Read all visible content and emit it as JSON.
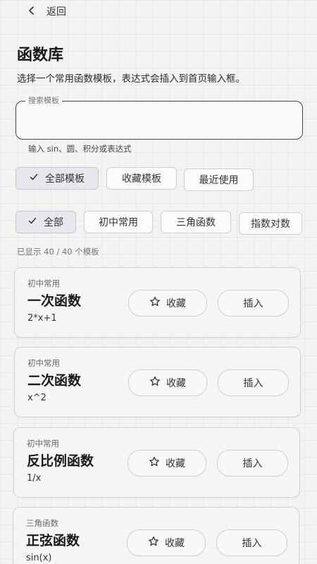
{
  "header": {
    "back_label": "返回"
  },
  "page": {
    "title": "函数库",
    "description": "选择一个常用函数模板，表达式会插入到首页输入框。"
  },
  "search": {
    "legend": "搜索模板",
    "value": "",
    "placeholder": "",
    "hint": "输入 sin、圆、积分或表达式"
  },
  "scope_tabs": [
    {
      "label": "全部模板",
      "selected": true
    },
    {
      "label": "收藏模板",
      "selected": false
    },
    {
      "label": "最近使用",
      "selected": false
    }
  ],
  "category_tabs": [
    {
      "label": "全部",
      "selected": true
    },
    {
      "label": "初中常用",
      "selected": false
    },
    {
      "label": "三角函数",
      "selected": false
    },
    {
      "label": "指数对数",
      "selected": false
    }
  ],
  "count_text": "已显示 40 / 40 个模板",
  "templates": [
    {
      "category": "初中常用",
      "name": "一次函数",
      "expr": "2*x+1",
      "fav_label": "收藏",
      "insert_label": "插入"
    },
    {
      "category": "初中常用",
      "name": "二次函数",
      "expr": "x^2",
      "fav_label": "收藏",
      "insert_label": "插入"
    },
    {
      "category": "初中常用",
      "name": "反比例函数",
      "expr": "1/x",
      "fav_label": "收藏",
      "insert_label": "插入"
    },
    {
      "category": "三角函数",
      "name": "正弦函数",
      "expr": "sin(x)",
      "fav_label": "收藏",
      "insert_label": "插入"
    }
  ],
  "icons": {
    "back": "chevron-left-icon",
    "check": "check-icon",
    "favorite": "star-outline-icon"
  }
}
